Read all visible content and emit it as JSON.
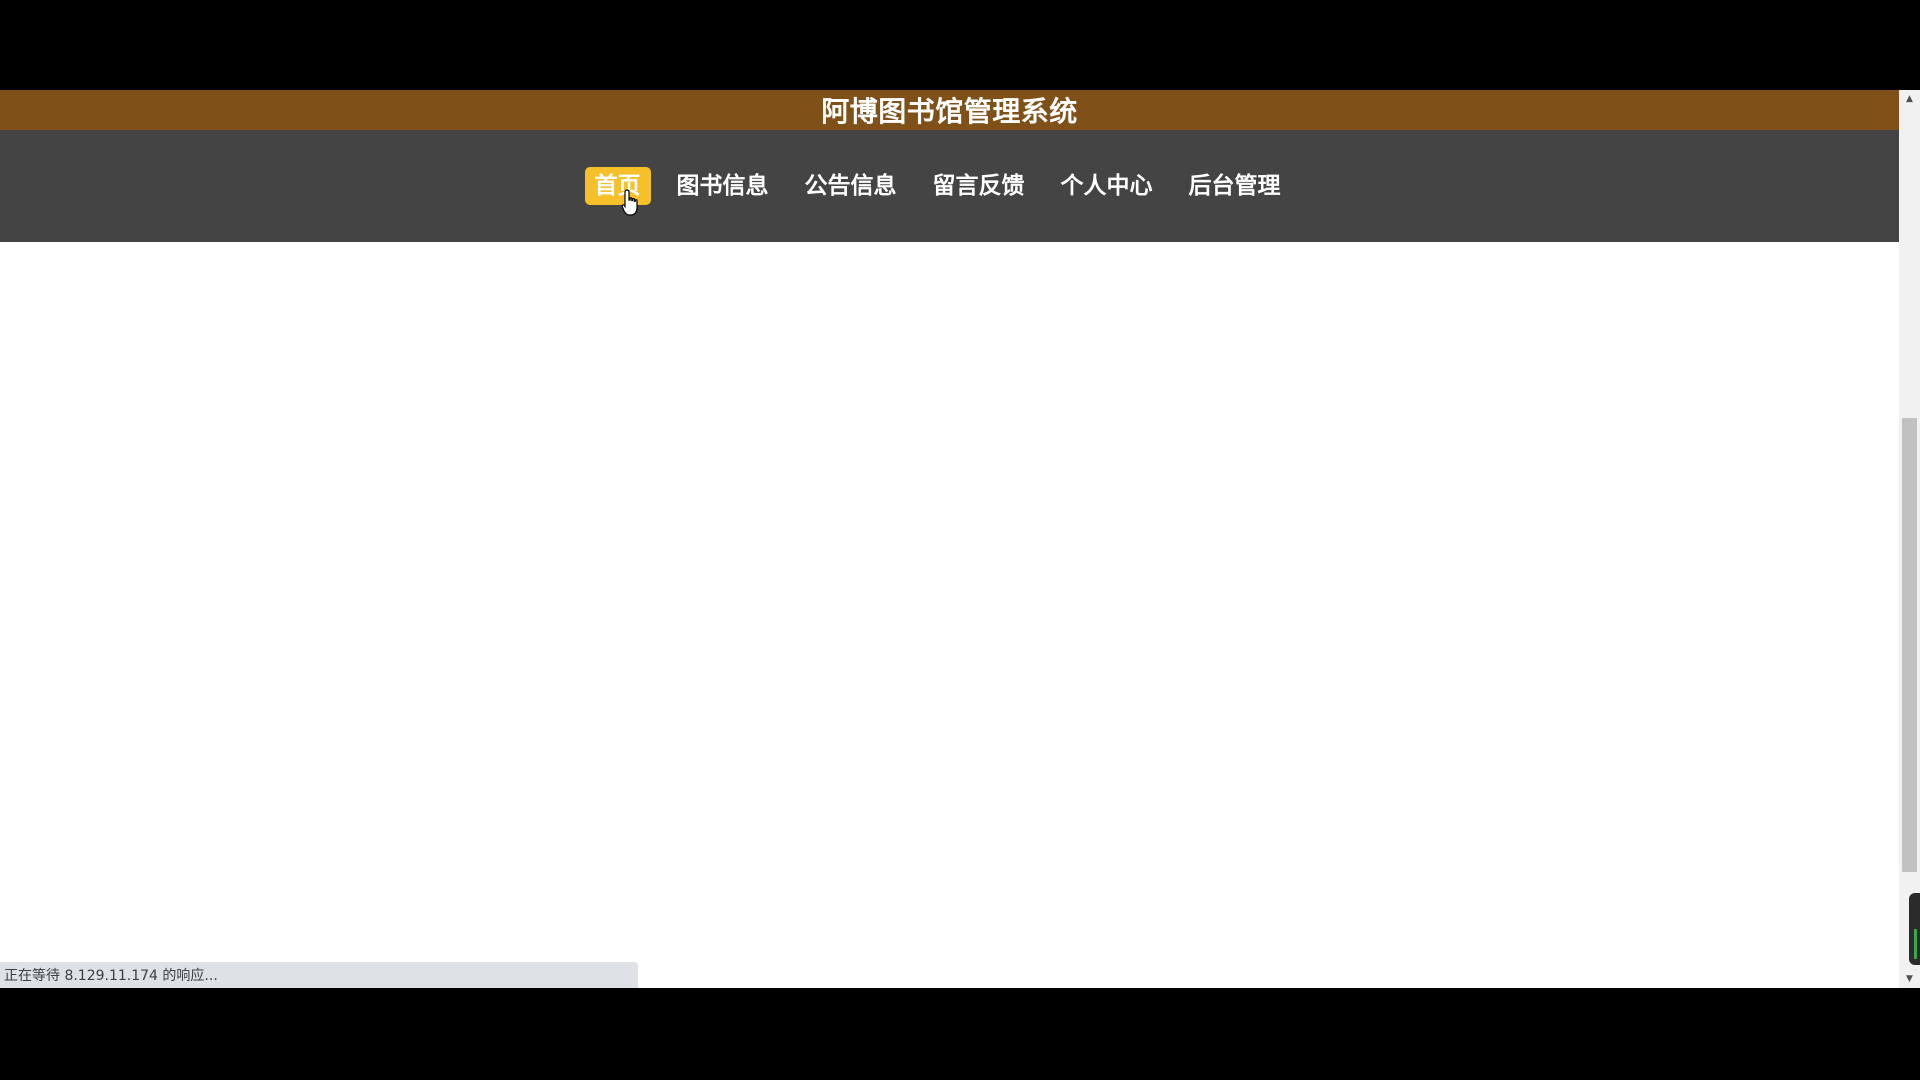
{
  "header": {
    "title": "阿博图书馆管理系统"
  },
  "nav": {
    "items": [
      {
        "label": "首页",
        "active": true
      },
      {
        "label": "图书信息",
        "active": false
      },
      {
        "label": "公告信息",
        "active": false
      },
      {
        "label": "留言反馈",
        "active": false
      },
      {
        "label": "个人中心",
        "active": false
      },
      {
        "label": "后台管理",
        "active": false
      }
    ]
  },
  "status_bar": {
    "text": "正在等待 8.129.11.174 的响应..."
  },
  "colors": {
    "title_bar_bg": "#7f5018",
    "nav_bar_bg": "#444444",
    "nav_active_bg": "#f5c02a",
    "page_bg": "#ffffff"
  },
  "icons": {
    "cursor": "hand-pointer-icon",
    "scroll_up": "triangle-up-icon",
    "scroll_down": "triangle-down-icon"
  }
}
